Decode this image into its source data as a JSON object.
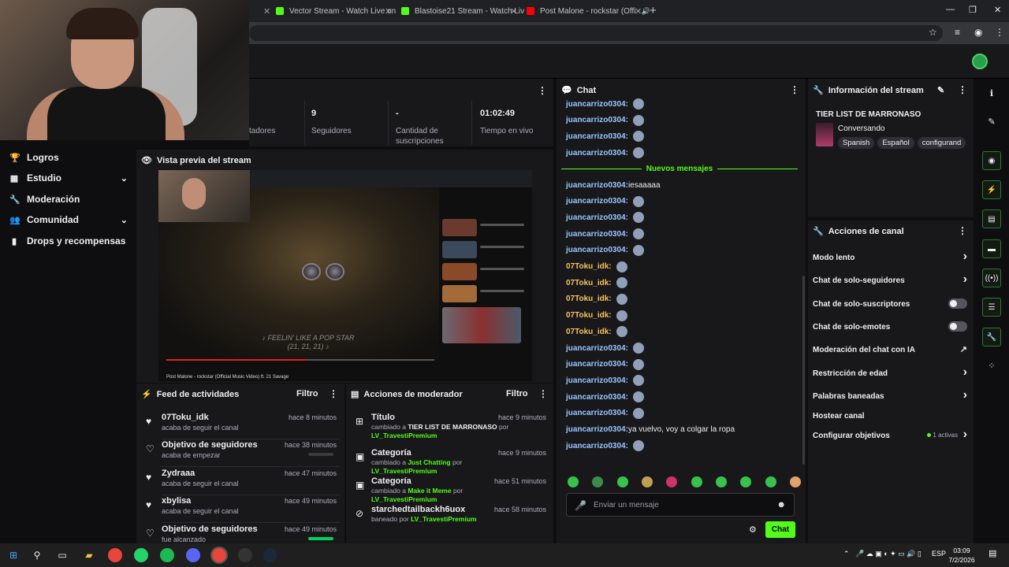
{
  "browser": {
    "tabs": [
      {
        "label": "Vector Stream - Watch Live on",
        "color": "#53fc18"
      },
      {
        "label": "Blastoise21 Stream - Watch Liv",
        "color": "#53fc18"
      },
      {
        "label": "Post Malone - rockstar (Offi",
        "color": "#ff0000"
      }
    ],
    "close_glyph": "✕",
    "newtab_glyph": "+"
  },
  "sidebar": {
    "items": [
      {
        "label": "Logros",
        "icon": "trophy-icon",
        "glyph": "🏆"
      },
      {
        "label": "Estudio",
        "icon": "grid-icon",
        "glyph": "▦",
        "chevron": "⌄"
      },
      {
        "label": "Moderación",
        "icon": "wrench-icon",
        "glyph": "🔧"
      },
      {
        "label": "Comunidad",
        "icon": "people-icon",
        "glyph": "👥",
        "chevron": "⌄"
      },
      {
        "label": "Drops y recompensas",
        "icon": "chart-icon",
        "glyph": "▮"
      }
    ]
  },
  "stats": {
    "partial_label": "tadores",
    "followers_value": "9",
    "followers_label": "Seguidores",
    "subs_value": "-",
    "subs_label": "Cantidad de suscripciones",
    "time_value": "01:02:49",
    "time_label": "Tiempo en vivo"
  },
  "preview": {
    "title": "Vista previa del stream",
    "caption": "♪ FEELIN' LIKE A POP STAR (21, 21, 21) ♪",
    "video_title": "Post Malone - rockstar (Official Music Video) ft. 21 Savage",
    "progress": 0.52
  },
  "feed": {
    "title": "Feed de actividades",
    "filter": "Filtro",
    "items": [
      {
        "name": "07Toku_idk",
        "sub": "acaba de seguir el canal",
        "time": "hace 8 minutos",
        "icon": "heart-filled-icon",
        "glyph": "♥"
      },
      {
        "name": "Objetivo de seguidores",
        "sub": "acaba de empezar",
        "time": "hace 38 minutos",
        "icon": "heart-outline-icon",
        "glyph": "♡",
        "progress": 0
      },
      {
        "name": "Zydraaa",
        "sub": "acaba de seguir el canal",
        "time": "hace 47 minutos",
        "icon": "heart-filled-icon",
        "glyph": "♥"
      },
      {
        "name": "xbylisa",
        "sub": "acaba de seguir el canal",
        "time": "hace 49 minutos",
        "icon": "heart-filled-icon",
        "glyph": "♥"
      },
      {
        "name": "Objetivo de seguidores",
        "sub": "fue alcanzado",
        "time": "hace 49 minutos",
        "icon": "heart-outline-icon",
        "glyph": "♡",
        "progress": 1
      }
    ]
  },
  "mod": {
    "title": "Acciones de moderador",
    "filter": "Filtro",
    "items": [
      {
        "name": "Título",
        "icon": "title-icon",
        "glyph": "⊞",
        "pre": "cambiado a ",
        "value": "TIER LIST DE MARRONASO",
        "mid": " por ",
        "user": "LV_TravestiPremium",
        "time": "hace 9 minutos"
      },
      {
        "name": "Categoría",
        "icon": "category-icon",
        "glyph": "▣",
        "pre": "cambiado a ",
        "value": "Just Chatting",
        "mid": " por ",
        "user": "LV_TravestiPremium",
        "time": "hace 9 minutos"
      },
      {
        "name": "Categoría",
        "icon": "category-icon",
        "glyph": "▣",
        "pre": "cambiado a ",
        "value": "Make it Meme",
        "mid": " por ",
        "user": "LV_TravestiPremium",
        "time": "hace 51 minutos"
      },
      {
        "name": "starchedtailbackh6uox",
        "icon": "ban-icon",
        "glyph": "⊘",
        "pre": "baneado por ",
        "value": "",
        "mid": "",
        "user": "LV_TravestiPremium",
        "time": "hace 58 minutos"
      }
    ]
  },
  "chat": {
    "title": "Chat",
    "new_messages": "Nuevos mensajes",
    "messages_before": [
      {
        "user": "juancarrizo0304:",
        "color": "blue",
        "emote": true
      },
      {
        "user": "juancarrizo0304:",
        "color": "blue",
        "emote": true
      },
      {
        "user": "juancarrizo0304:",
        "color": "blue",
        "emote": true
      },
      {
        "user": "juancarrizo0304:",
        "color": "blue",
        "emote": true
      }
    ],
    "messages_after": [
      {
        "user": "juancarrizo0304:",
        "color": "blue",
        "text": " iesaaaaa"
      },
      {
        "user": "juancarrizo0304:",
        "color": "blue",
        "emote": true
      },
      {
        "user": "juancarrizo0304:",
        "color": "blue",
        "emote": true
      },
      {
        "user": "juancarrizo0304:",
        "color": "blue",
        "emote": true
      },
      {
        "user": "juancarrizo0304:",
        "color": "blue",
        "emote": true
      },
      {
        "user": "07Toku_idk:",
        "color": "yel",
        "emote": true
      },
      {
        "user": "07Toku_idk:",
        "color": "yel",
        "emote": true
      },
      {
        "user": "07Toku_idk:",
        "color": "yel",
        "emote": true
      },
      {
        "user": "07Toku_idk:",
        "color": "yel",
        "emote": true
      },
      {
        "user": "07Toku_idk:",
        "color": "yel",
        "emote": true
      },
      {
        "user": "juancarrizo0304:",
        "color": "blue",
        "emote": true
      },
      {
        "user": "juancarrizo0304:",
        "color": "blue",
        "emote": true
      },
      {
        "user": "juancarrizo0304:",
        "color": "blue",
        "emote": true
      },
      {
        "user": "juancarrizo0304:",
        "color": "blue",
        "emote": true
      },
      {
        "user": "juancarrizo0304:",
        "color": "blue",
        "emote": true
      },
      {
        "user": "juancarrizo0304:",
        "color": "blue",
        "text": " ya vuelvo, voy a colgar la ropa"
      },
      {
        "user": "juancarrizo0304:",
        "color": "blue",
        "emote": true
      }
    ],
    "placeholder": "Enviar un mensaje",
    "send_label": "Chat"
  },
  "info": {
    "title": "Información del stream",
    "stream_title": "TIER LIST DE MARRONASO",
    "category": "Conversando",
    "tags": [
      "Spanish",
      "Español",
      "configurand"
    ]
  },
  "channel": {
    "title": "Acciones de canal",
    "items": [
      {
        "label": "Modo lento",
        "kind": "chevron"
      },
      {
        "label": "Chat de solo-seguidores",
        "kind": "chevron"
      },
      {
        "label": "Chat de solo-suscriptores",
        "kind": "toggle"
      },
      {
        "label": "Chat de solo-emotes",
        "kind": "toggle"
      },
      {
        "label": "Moderación del chat con IA",
        "kind": "external"
      },
      {
        "label": "Restricción de edad",
        "kind": "chevron"
      },
      {
        "label": "Palabras baneadas",
        "kind": "chevron"
      },
      {
        "label": "Hostear canal",
        "kind": "none"
      },
      {
        "label": "Configurar objetivos",
        "kind": "chevron",
        "badge": "1 activas"
      }
    ]
  },
  "taskbar": {
    "lang": "ESP",
    "time": "03:09",
    "date": "7/2/2026"
  },
  "colors": {
    "accent": "#53fc18",
    "panel": "#18181b",
    "bg": "#0e0e10"
  }
}
